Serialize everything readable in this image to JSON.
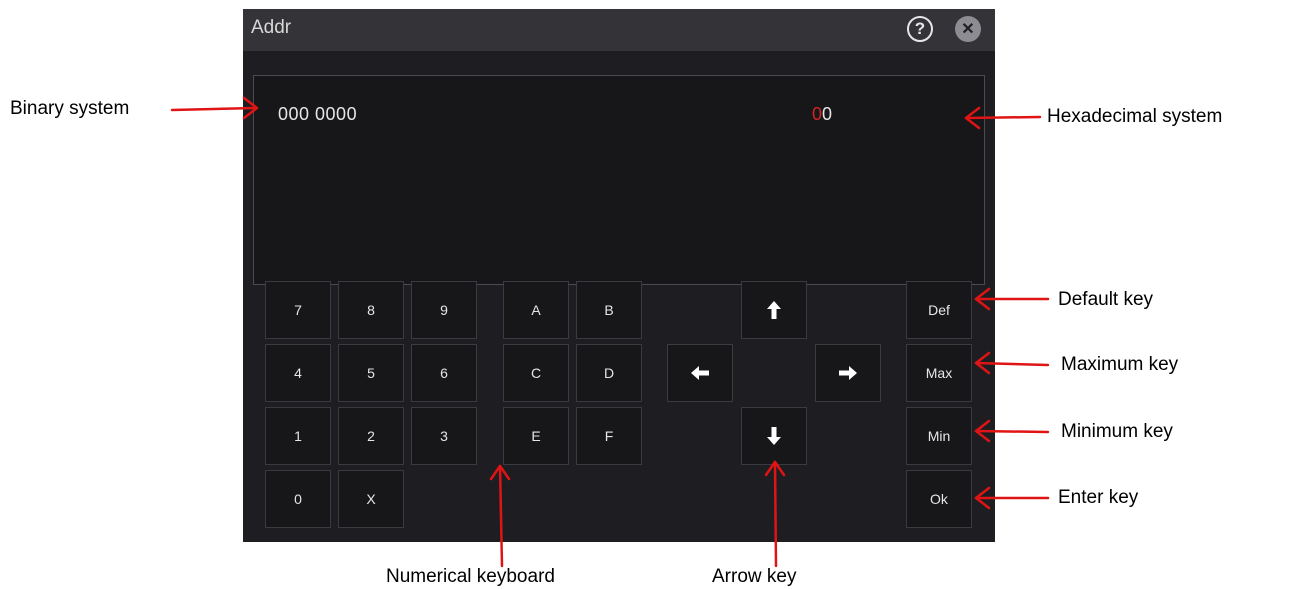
{
  "dialog": {
    "title": "Addr",
    "help_icon_glyph": "?",
    "close_icon_glyph": "✕"
  },
  "display": {
    "binary": "000 0000",
    "hex_active_digit": "0",
    "hex_rest": "0",
    "hex_active_color": "#d42424"
  },
  "keypad": {
    "k7": "7",
    "k8": "8",
    "k9": "9",
    "k4": "4",
    "k5": "5",
    "k6": "6",
    "k1": "1",
    "k2": "2",
    "k3": "3",
    "k0": "0",
    "kx": "X",
    "ka": "A",
    "kb": "B",
    "kc": "C",
    "kd": "D",
    "ke": "E",
    "kf": "F"
  },
  "arrows": {
    "up": "arrow-up-icon",
    "down": "arrow-down-icon",
    "left": "arrow-left-icon",
    "right": "arrow-right-icon"
  },
  "function_keys": {
    "def": "Def",
    "max": "Max",
    "min": "Min",
    "ok": "Ok"
  },
  "annotations": {
    "binary_system": "Binary system",
    "hexadecimal_system": "Hexadecimal system",
    "default_key": "Default key",
    "maximum_key": "Maximum key",
    "minimum_key": "Minimum key",
    "enter_key": "Enter key",
    "numerical_keyboard": "Numerical keyboard",
    "arrow_key": "Arrow key",
    "arrow_color": "#e01414"
  }
}
